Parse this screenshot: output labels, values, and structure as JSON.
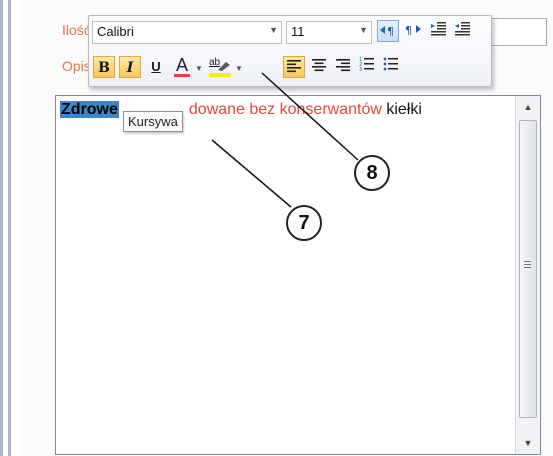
{
  "form": {
    "ilosc_label": "Ilość",
    "opis_label": "Opis"
  },
  "toolbar": {
    "font_name": "Calibri",
    "font_size": "11",
    "bold_label": "B",
    "italic_label": "I",
    "underline_label": "U",
    "font_color_label": "A",
    "highlight_label": "ab"
  },
  "editor": {
    "selected_word": "Zdrowe",
    "text_red": "dowane bez konserwantów",
    "text_dark": " kiełki"
  },
  "tooltip": {
    "text": "Kursywa"
  },
  "callouts": {
    "c7": "7",
    "c8": "8"
  },
  "colors": {
    "accent_label": "#e3734b",
    "selection": "#3a86c9",
    "red_text": "#e2473d",
    "active_button": "#f9c75a"
  }
}
